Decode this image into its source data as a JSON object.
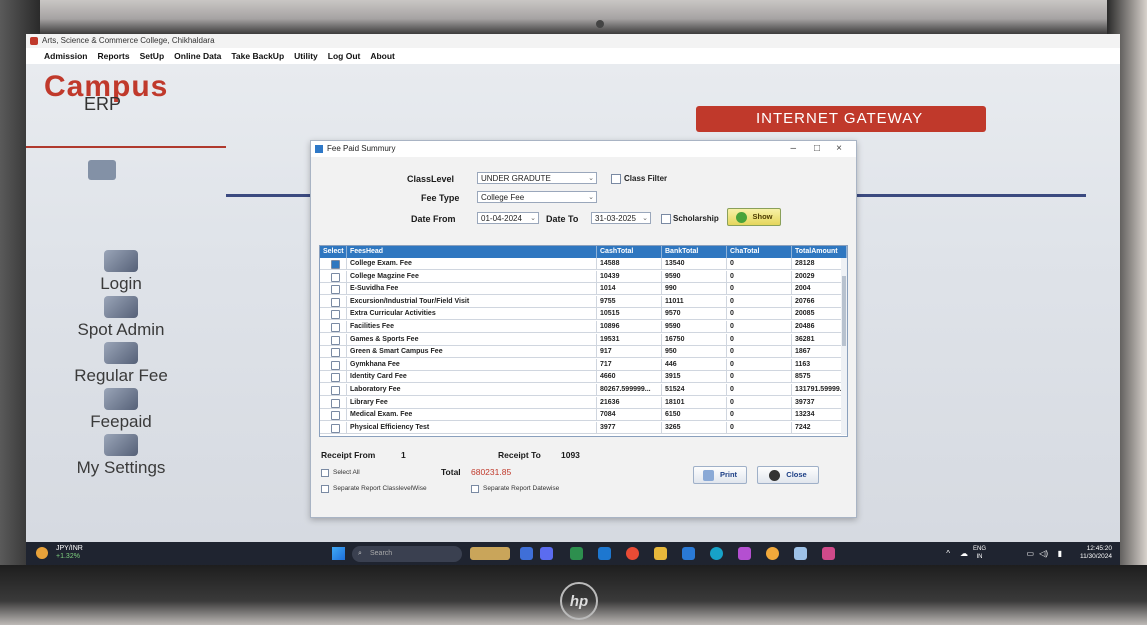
{
  "window": {
    "title": "Arts, Science & Commerce College, Chikhaldara"
  },
  "menu": [
    "Admission",
    "Reports",
    "SetUp",
    "Online Data",
    "Take BackUp",
    "Utility",
    "Log Out",
    "About"
  ],
  "brand": {
    "logo_main": "Campus",
    "logo_sub": "ERP",
    "banner": "INTERNET GATEWAY"
  },
  "sidebar": [
    {
      "label": "Login",
      "icon": "key-icon"
    },
    {
      "label": "Spot Admin",
      "icon": "admin-icon"
    },
    {
      "label": "Regular Fee",
      "icon": "fee-icon"
    },
    {
      "label": "Feepaid",
      "icon": "people-icon"
    },
    {
      "label": "My Settings",
      "icon": "settings-icon"
    }
  ],
  "dialog": {
    "title": "Fee Paid Summury",
    "controls": {
      "minimize": "–",
      "maximize": "□",
      "close": "×"
    },
    "class_level_label": "ClassLevel",
    "class_level_value": "UNDER GRADUTE",
    "class_filter_label": "Class Filter",
    "fee_type_label": "Fee Type",
    "fee_type_value": "College Fee",
    "date_from_label": "Date From",
    "date_from_value": "01-04-2024",
    "date_to_label": "Date To",
    "date_to_value": "31-03-2025",
    "scholarship_label": "Scholarship",
    "show_label": "Show",
    "columns": [
      "Select",
      "FeesHead",
      "CashTotal",
      "BankTotal",
      "ChaTotal",
      "TotalAmount"
    ],
    "rows": [
      {
        "head": "College Exam. Fee",
        "cash": "14588",
        "bank": "13540",
        "cha": "0",
        "total": "28128",
        "selected": true
      },
      {
        "head": "College Magzine Fee",
        "cash": "10439",
        "bank": "9590",
        "cha": "0",
        "total": "20029",
        "selected": false
      },
      {
        "head": "E-Suvidha Fee",
        "cash": "1014",
        "bank": "990",
        "cha": "0",
        "total": "2004",
        "selected": false
      },
      {
        "head": "Excursion/Industrial Tour/Field Visit",
        "cash": "9755",
        "bank": "11011",
        "cha": "0",
        "total": "20766",
        "selected": false
      },
      {
        "head": "Extra Curricular Activities",
        "cash": "10515",
        "bank": "9570",
        "cha": "0",
        "total": "20085",
        "selected": false
      },
      {
        "head": "Facilities Fee",
        "cash": "10896",
        "bank": "9590",
        "cha": "0",
        "total": "20486",
        "selected": false
      },
      {
        "head": "Games & Sports Fee",
        "cash": "19531",
        "bank": "16750",
        "cha": "0",
        "total": "36281",
        "selected": false
      },
      {
        "head": "Green & Smart Campus Fee",
        "cash": "917",
        "bank": "950",
        "cha": "0",
        "total": "1867",
        "selected": false
      },
      {
        "head": "Gymkhana Fee",
        "cash": "717",
        "bank": "446",
        "cha": "0",
        "total": "1163",
        "selected": false
      },
      {
        "head": "Identity Card Fee",
        "cash": "4660",
        "bank": "3915",
        "cha": "0",
        "total": "8575",
        "selected": false
      },
      {
        "head": "Laboratory Fee",
        "cash": "80267.599999...",
        "bank": "51524",
        "cha": "0",
        "total": "131791.59999.",
        "selected": false
      },
      {
        "head": "Library Fee",
        "cash": "21636",
        "bank": "18101",
        "cha": "0",
        "total": "39737",
        "selected": false
      },
      {
        "head": "Medical Exam. Fee",
        "cash": "7084",
        "bank": "6150",
        "cha": "0",
        "total": "13234",
        "selected": false
      },
      {
        "head": "Physical Efficiency Test",
        "cash": "3977",
        "bank": "3265",
        "cha": "0",
        "total": "7242",
        "selected": false
      }
    ],
    "receipt_from_label": "Receipt From",
    "receipt_from_value": "1",
    "receipt_to_label": "Receipt To",
    "receipt_to_value": "1093",
    "select_all_label": "Select All",
    "total_label": "Total",
    "total_value": "680231.85",
    "sep_class_label": "Separate Report ClasslevelWise",
    "sep_date_label": "Separate Report Datewise",
    "print_label": "Print",
    "close_label": "Close"
  },
  "taskbar": {
    "ticker_name": "JPY/INR",
    "ticker_change": "+1.32%",
    "search_placeholder": "Search",
    "lang_top": "ENG",
    "lang_bottom": "IN",
    "time": "12:45:20",
    "date": "11/30/2024"
  },
  "device": {
    "brand": "hp"
  },
  "colors": {
    "accent": "#c0392b",
    "grid_header": "#2f77c0",
    "total": "#c0392b"
  }
}
